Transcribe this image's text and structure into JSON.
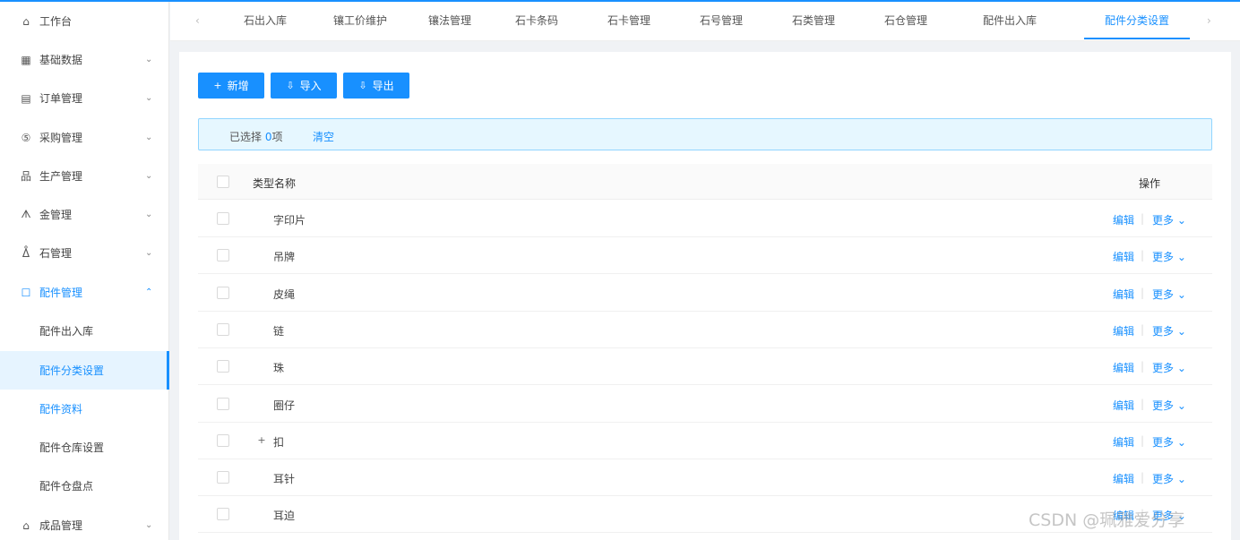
{
  "sidebar": {
    "items": [
      {
        "label": "工作台",
        "icon": "home-icon",
        "glyph": "⌂",
        "expandable": false
      },
      {
        "label": "基础数据",
        "icon": "grid-icon",
        "glyph": "▦",
        "expandable": true
      },
      {
        "label": "订单管理",
        "icon": "order-icon",
        "glyph": "▤",
        "expandable": true
      },
      {
        "label": "采购管理",
        "icon": "purchase-icon",
        "glyph": "⑤",
        "expandable": true
      },
      {
        "label": "生产管理",
        "icon": "production-icon",
        "glyph": "品",
        "expandable": true
      },
      {
        "label": "金管理",
        "icon": "gold-icon",
        "glyph": "ᗑ",
        "expandable": true
      },
      {
        "label": "石管理",
        "icon": "stone-icon",
        "glyph": "ᐂ",
        "expandable": true
      },
      {
        "label": "配件管理",
        "icon": "parts-icon",
        "glyph": "☐",
        "expandable": true,
        "open": true
      },
      {
        "label": "成品管理",
        "icon": "product-icon",
        "glyph": "⌂",
        "expandable": true
      }
    ],
    "sub_items": [
      {
        "label": "配件出入库"
      },
      {
        "label": "配件分类设置",
        "active": true
      },
      {
        "label": "配件资料",
        "selected": true
      },
      {
        "label": "配件仓库设置"
      },
      {
        "label": "配件仓盘点"
      }
    ],
    "chevron_down": "⌄",
    "chevron_up": "⌃"
  },
  "tabs": {
    "prev_arrow": "‹",
    "next_arrow": "›",
    "items": [
      {
        "label": "石出入库"
      },
      {
        "label": "镶工价维护"
      },
      {
        "label": "镶法管理"
      },
      {
        "label": "石卡条码"
      },
      {
        "label": "石卡管理"
      },
      {
        "label": "石号管理"
      },
      {
        "label": "石类管理"
      },
      {
        "label": "石仓管理"
      },
      {
        "label": "配件出入库"
      },
      {
        "label": "配件分类设置",
        "active": true
      }
    ]
  },
  "toolbar": {
    "add": {
      "label": "新增",
      "icon": "plus-icon",
      "glyph": "+"
    },
    "import": {
      "label": "导入",
      "icon": "upload-icon",
      "glyph": "⇩"
    },
    "export": {
      "label": "导出",
      "icon": "download-icon",
      "glyph": "⇩"
    }
  },
  "alert": {
    "prefix": "已选择 ",
    "count": "0",
    "suffix": "项",
    "clear": "清空"
  },
  "table": {
    "columns": {
      "name": "类型名称",
      "actions": "操作"
    },
    "rows": [
      {
        "name": "字印片"
      },
      {
        "name": "吊牌"
      },
      {
        "name": "皮绳"
      },
      {
        "name": "链"
      },
      {
        "name": "珠"
      },
      {
        "name": "圈仔"
      },
      {
        "name": "扣",
        "expandable": true
      },
      {
        "name": "耳针"
      },
      {
        "name": "耳迫"
      }
    ],
    "edit_label": "编辑",
    "separator": "|",
    "more_label": "更多 ⌄",
    "expand_glyph": "+"
  },
  "watermark": "CSDN @珮雅爱分享",
  "colors": {
    "primary": "#1890ff",
    "alert_bg": "#e6f7ff",
    "alert_border": "#91d5ff"
  }
}
